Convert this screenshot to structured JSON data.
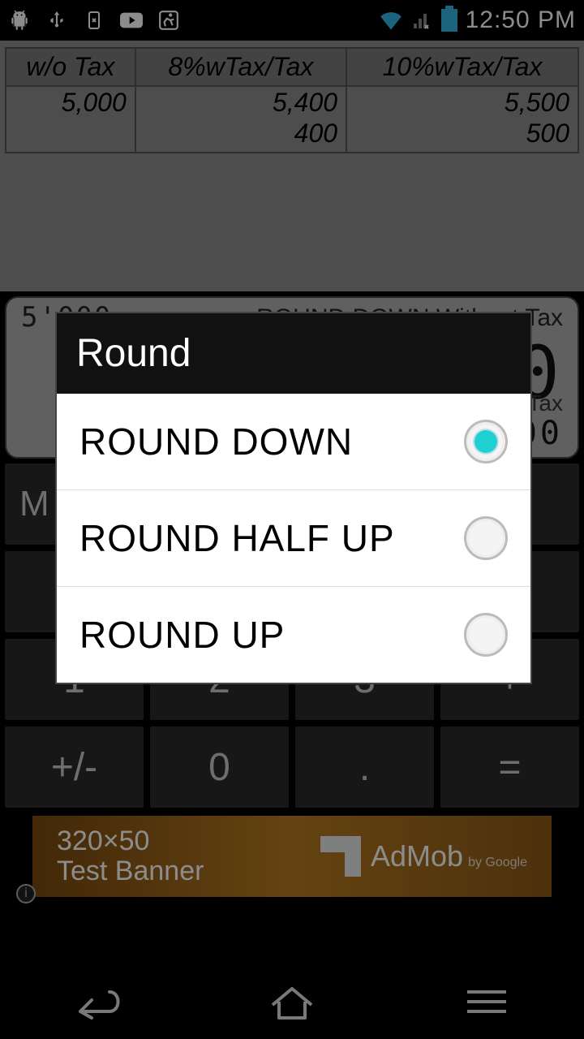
{
  "status": {
    "time": "12:50 PM"
  },
  "tax_table": {
    "headers": [
      "w/o Tax",
      "8%wTax/Tax",
      "10%wTax/Tax"
    ],
    "rows": [
      [
        "5,000",
        "5,400",
        "5,500"
      ],
      [
        "",
        "400",
        "500"
      ]
    ]
  },
  "display": {
    "top_left": "5'000",
    "top_right_mode": "ROUND DOWN Without Tax",
    "main_value": "5'000",
    "sub_label": "Tax",
    "sub_value": "00"
  },
  "keypad": {
    "memory": "M",
    "r0": [
      "",
      "",
      "",
      ""
    ],
    "r1": [
      "",
      "",
      "",
      ""
    ],
    "r2": [
      "1",
      "2",
      "3",
      "+"
    ],
    "r3": [
      "+/-",
      "0",
      ".",
      "="
    ]
  },
  "ad": {
    "size": "320×50",
    "label": "Test Banner",
    "brand": "AdMob",
    "by": "by Google"
  },
  "dialog": {
    "title": "Round",
    "options": [
      {
        "label": "ROUND DOWN",
        "selected": true
      },
      {
        "label": "ROUND HALF UP",
        "selected": false
      },
      {
        "label": "ROUND UP",
        "selected": false
      }
    ]
  }
}
